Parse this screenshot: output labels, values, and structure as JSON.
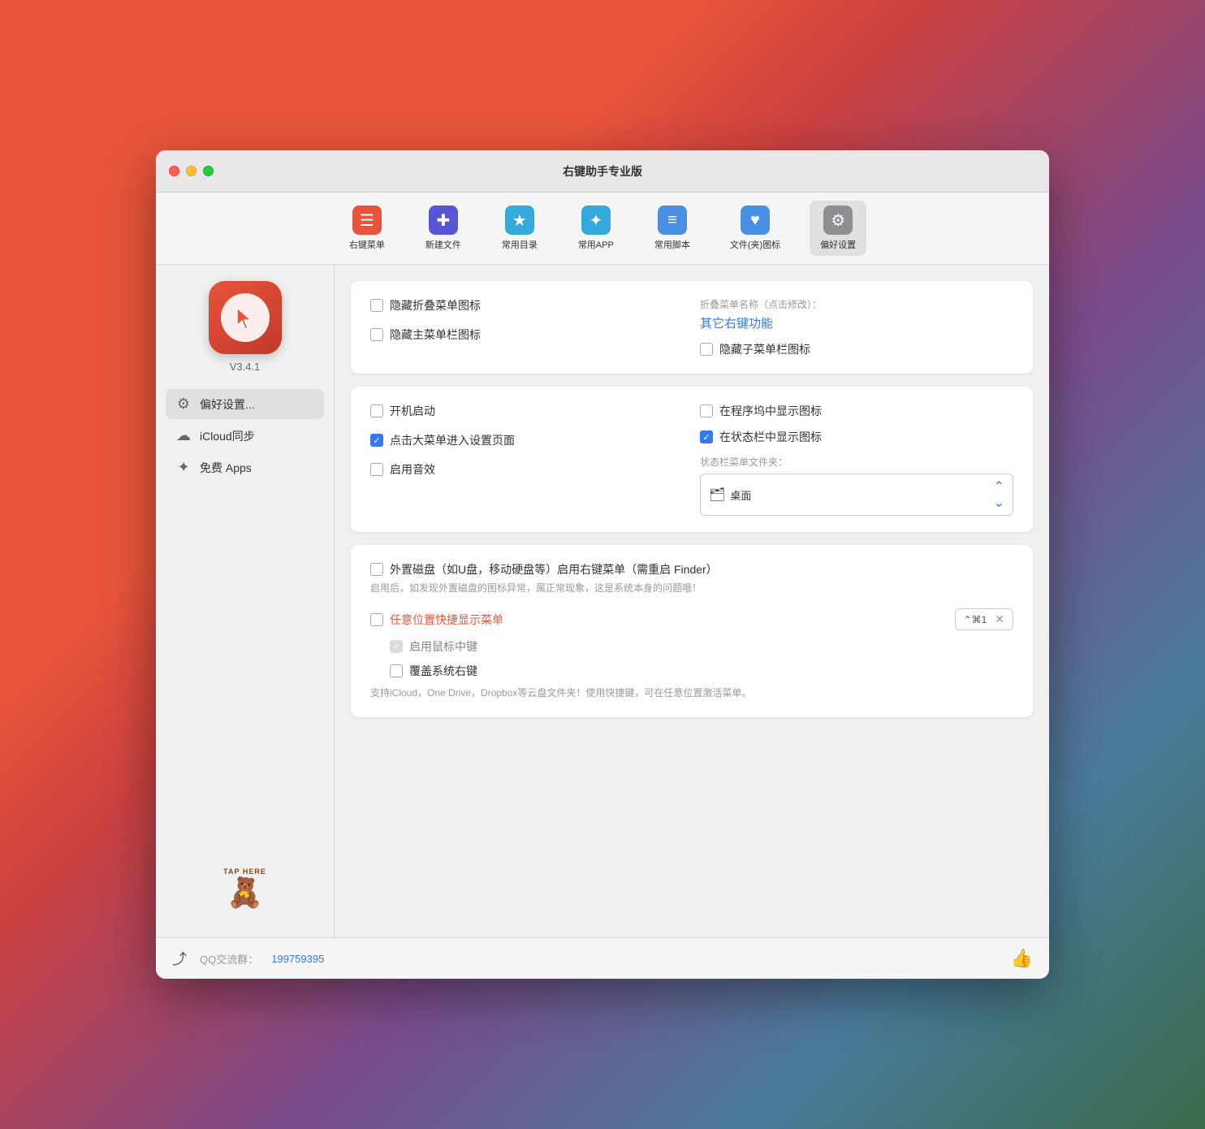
{
  "window": {
    "title": "右键助手专业版"
  },
  "toolbar": {
    "items": [
      {
        "id": "right-click-menu",
        "label": "右键菜单",
        "icon": "☰",
        "color_class": "icon-menu",
        "active": false
      },
      {
        "id": "new-file",
        "label": "新建文件",
        "icon": "✚",
        "color_class": "icon-new",
        "active": false
      },
      {
        "id": "common-dir",
        "label": "常用目录",
        "icon": "★",
        "color_class": "icon-dir",
        "active": false
      },
      {
        "id": "common-app",
        "label": "常用APP",
        "icon": "✦",
        "color_class": "icon-app",
        "active": false
      },
      {
        "id": "common-script",
        "label": "常用脚本",
        "icon": "≡",
        "color_class": "icon-script",
        "active": false
      },
      {
        "id": "file-folder-icon",
        "label": "文件(夹)图标",
        "icon": "♥",
        "color_class": "icon-filefolder",
        "active": false
      },
      {
        "id": "preferences",
        "label": "偏好设置",
        "icon": "⚙",
        "color_class": "icon-settings",
        "active": true
      }
    ]
  },
  "sidebar": {
    "app_icon_alt": "右键助手",
    "version": "V3.4.1",
    "menu_items": [
      {
        "id": "preferences",
        "label": "偏好设置...",
        "icon": "⚙",
        "active": true
      },
      {
        "id": "icloud-sync",
        "label": "iCloud同步",
        "icon": "☁",
        "active": false
      },
      {
        "id": "free-apps",
        "label": "免费 Apps",
        "icon": "✦",
        "active": false
      }
    ],
    "tap_here_label": "TAP HERE"
  },
  "main": {
    "card1": {
      "left": {
        "checkbox1": {
          "label": "隐藏折叠菜单图标",
          "checked": false
        },
        "checkbox2": {
          "label": "隐藏主菜单栏图标",
          "checked": false
        }
      },
      "right": {
        "fold_name_label": "折叠菜单名称（点击修改）：",
        "fold_name_value": "其它右键功能",
        "checkbox_hidden_submenu": {
          "label": "隐藏子菜单栏图标",
          "checked": false
        }
      }
    },
    "card2": {
      "left": {
        "checkbox_startup": {
          "label": "开机启动",
          "checked": false
        },
        "checkbox_click_main": {
          "label": "点击大菜单进入设置页面",
          "checked": true
        },
        "checkbox_sound": {
          "label": "启用音效",
          "checked": false
        }
      },
      "right": {
        "checkbox_show_dock": {
          "label": "在程序坞中显示图标",
          "checked": false
        },
        "checkbox_show_statusbar": {
          "label": "在状态栏中显示图标",
          "checked": true
        },
        "statusbar_folder_label": "状态栏菜单文件夹：",
        "folder_name": "桌面"
      }
    },
    "card3": {
      "external_disk_label": "外置磁盘（如U盘，移动硬盘等）启用右键菜单（需重启 Finder）",
      "external_disk_hint": "启用后，如发现外置磁盘的图标异常，属正常现象，这是系统本身的问题哦！",
      "external_disk_checked": false,
      "anywhere_label": "任意位置快捷显示菜单",
      "anywhere_checked": false,
      "shortcut_display": "⌃⌘1",
      "sub_checkbox1": {
        "label": "启用鼠标中键",
        "checked": true,
        "gray": true
      },
      "sub_checkbox2": {
        "label": "覆盖系统右键",
        "checked": false
      },
      "support_text": "支持iCloud，One Drive，Dropbox等云盘文件夹！使用快捷键，可在任意位置激活菜单。"
    },
    "bottom_bar": {
      "export_icon": "⤴",
      "qq_label": "QQ交流群：",
      "qq_number": "199759395",
      "like_icon": "👍"
    }
  }
}
